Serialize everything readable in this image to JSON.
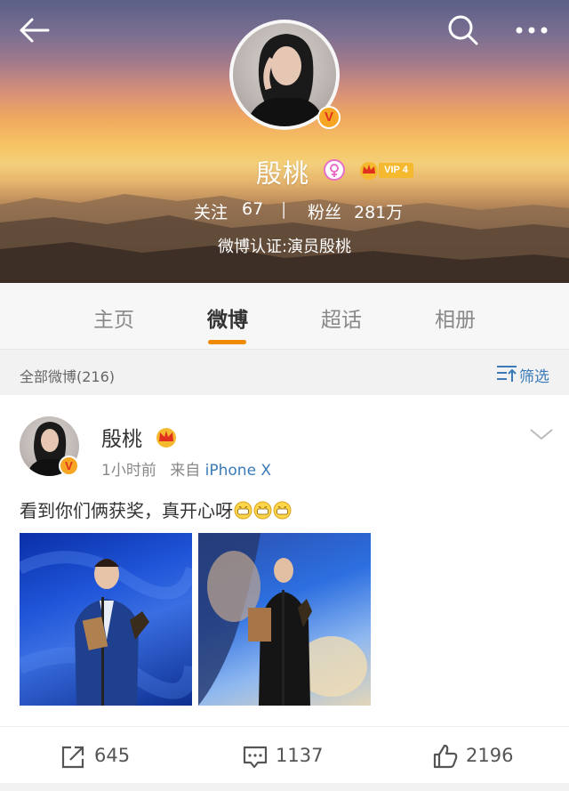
{
  "profile": {
    "name": "殷桃",
    "vip_level": "VIP 4",
    "following_label": "关注",
    "following_count": "67",
    "fans_label": "粉丝",
    "fans_count": "281万",
    "verification": "微博认证:演员殷桃"
  },
  "tabs": [
    {
      "label": "主页"
    },
    {
      "label": "微博"
    },
    {
      "label": "超话"
    },
    {
      "label": "相册"
    }
  ],
  "filter": {
    "count_label": "全部微博(216)",
    "filter_label": "筛选"
  },
  "post": {
    "author": "殷桃",
    "time": "1小时前",
    "source_prefix": "来自",
    "source": "iPhone X",
    "text": "看到你们俩获奖，真开心呀",
    "reposts": "645",
    "comments": "1137",
    "likes": "2196"
  },
  "colors": {
    "accent": "#f08a00",
    "link": "#3a7bb8",
    "verified_badge": "#f6a623"
  },
  "icons": [
    "back-arrow-icon",
    "search-icon",
    "more-icon",
    "verified-icon",
    "female-icon",
    "crown-icon",
    "chevron-down-icon",
    "filter-icon",
    "repost-icon",
    "comment-icon",
    "like-icon",
    "grin-emoji-icon"
  ]
}
